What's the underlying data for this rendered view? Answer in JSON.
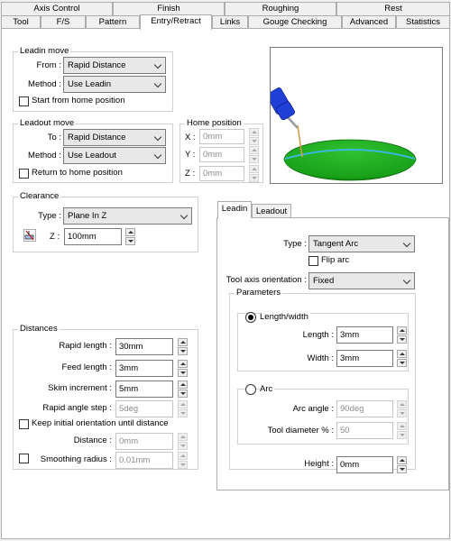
{
  "tabs_top": [
    "Axis Control",
    "Finish",
    "Roughing",
    "Rest"
  ],
  "tabs_bottom": [
    "Tool",
    "F/S",
    "Pattern",
    "Entry/Retract",
    "Links",
    "Gouge Checking",
    "Advanced",
    "Statistics"
  ],
  "active_tab": "Entry/Retract",
  "leadin_move": {
    "title": "Leadin move",
    "from_label": "From :",
    "from_value": "Rapid Distance",
    "method_label": "Method :",
    "method_value": "Use Leadin",
    "start_home_label": "Start from home position",
    "start_home_checked": false
  },
  "leadout_move": {
    "title": "Leadout move",
    "to_label": "To :",
    "to_value": "Rapid Distance",
    "method_label": "Method :",
    "method_value": "Use Leadout",
    "return_home_label": "Return to home position",
    "return_home_checked": false
  },
  "home_position": {
    "title": "Home position",
    "x_label": "X :",
    "x_value": "0mm",
    "y_label": "Y :",
    "y_value": "0mm",
    "z_label": "Z :",
    "z_value": "0mm"
  },
  "clearance": {
    "title": "Clearance",
    "type_label": "Type :",
    "type_value": "Plane In Z",
    "z_label": "Z :",
    "z_value": "100mm",
    "icon": "plane-pick-icon"
  },
  "distances": {
    "title": "Distances",
    "rapid_length_label": "Rapid length :",
    "rapid_length_value": "30mm",
    "feed_length_label": "Feed length :",
    "feed_length_value": "3mm",
    "skim_increment_label": "Skim increment :",
    "skim_increment_value": "5mm",
    "rapid_angle_label": "Rapid angle step :",
    "rapid_angle_value": "5deg",
    "keep_orientation_label": "Keep initial orientation until distance",
    "keep_orientation_checked": false,
    "distance_label": "Distance :",
    "distance_value": "0mm",
    "smoothing_label": "Smoothing radius :",
    "smoothing_value": "0.01mm",
    "smoothing_checked": false
  },
  "leadin_panel": {
    "tabs": [
      "Leadin",
      "Leadout"
    ],
    "active_tab": "Leadin",
    "type_label": "Type :",
    "type_value": "Tangent Arc",
    "flip_arc_label": "Flip arc",
    "flip_arc_checked": false,
    "tool_axis_label": "Tool axis orientation :",
    "tool_axis_value": "Fixed",
    "parameters_title": "Parameters",
    "length_width_label": "Length/width",
    "length_width_selected": true,
    "length_label": "Length :",
    "length_value": "3mm",
    "width_label": "Width :",
    "width_value": "3mm",
    "arc_label": "Arc",
    "arc_selected": false,
    "arc_angle_label": "Arc angle :",
    "arc_angle_value": "90deg",
    "tool_diameter_label": "Tool diameter % :",
    "tool_diameter_value": "50",
    "height_label": "Height :",
    "height_value": "0mm"
  },
  "colors": {
    "tool_blue": "#1f3fd6",
    "part_green": "#1aa51a",
    "lead_orange": "#d89a4a",
    "path_cyan": "#3ab8d8"
  }
}
